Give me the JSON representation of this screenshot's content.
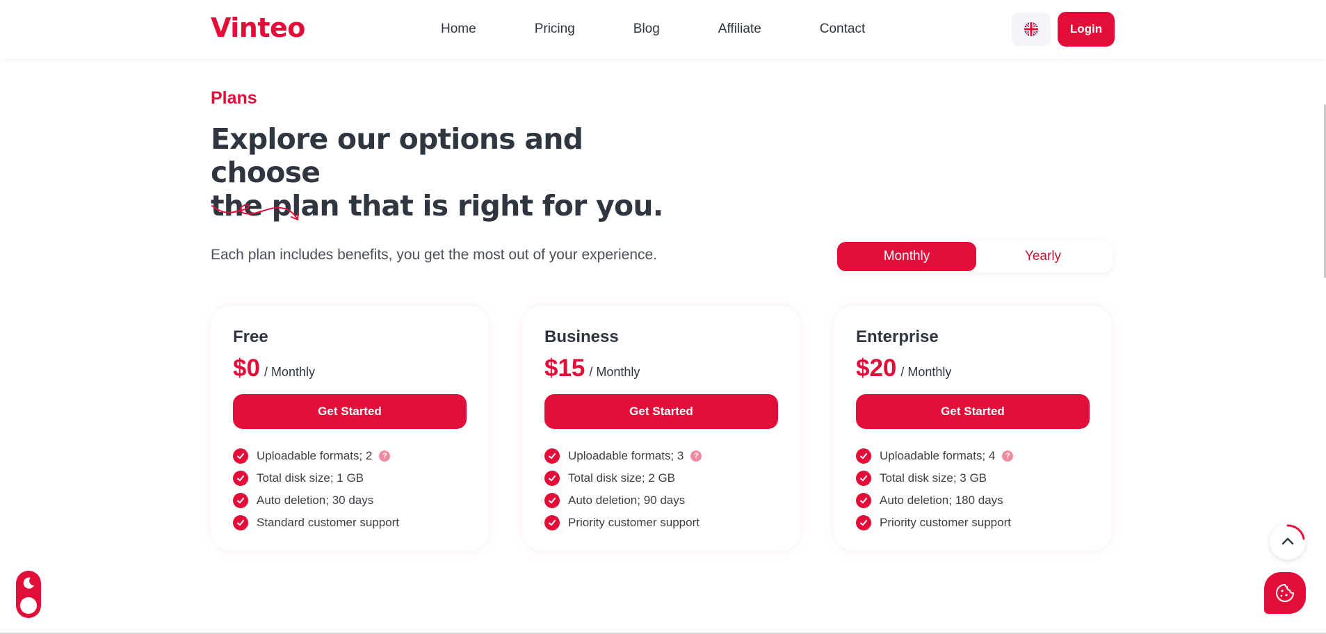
{
  "brand": {
    "name": "Vinteo",
    "accent_color": "#e30d3a"
  },
  "nav": {
    "items": [
      {
        "label": "Home"
      },
      {
        "label": "Pricing"
      },
      {
        "label": "Blog"
      },
      {
        "label": "Affiliate"
      },
      {
        "label": "Contact"
      }
    ]
  },
  "header": {
    "language_icon": "uk-flag-icon",
    "login_label": "Login"
  },
  "hero": {
    "eyebrow": "Plans",
    "headline_line1": "Explore our options and choose",
    "headline_line2": "the plan that is right for you.",
    "subtext": "Each plan includes benefits, you get the most out of your experience."
  },
  "billing_toggle": {
    "monthly_label": "Monthly",
    "yearly_label": "Yearly",
    "selected": "Monthly"
  },
  "plans": [
    {
      "name": "Free",
      "price": "$0",
      "period": "/ Monthly",
      "cta": "Get Started",
      "features": [
        "Uploadable formats; 2",
        "Total disk size; 1 GB",
        "Auto deletion; 30 days",
        "Standard customer support"
      ]
    },
    {
      "name": "Business",
      "price": "$15",
      "period": "/ Monthly",
      "cta": "Get Started",
      "features": [
        "Uploadable formats; 3",
        "Total disk size; 2 GB",
        "Auto deletion; 90 days",
        "Priority customer support"
      ]
    },
    {
      "name": "Enterprise",
      "price": "$20",
      "period": "/ Monthly",
      "cta": "Get Started",
      "features": [
        "Uploadable formats; 4",
        "Total disk size; 3 GB",
        "Auto deletion; 180 days",
        "Priority customer support"
      ]
    }
  ],
  "floating": {
    "theme_toggle_icons": [
      "moon-icon",
      "sun-icon"
    ],
    "scroll_top_icon": "chevron-up-icon",
    "cookie_icon": "cookie-icon"
  }
}
